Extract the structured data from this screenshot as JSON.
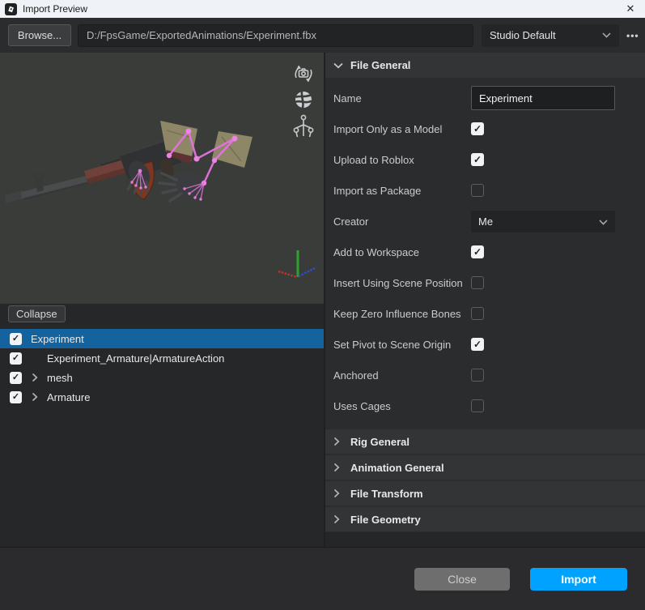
{
  "window": {
    "title": "Import Preview"
  },
  "glyphs": {
    "check": "✓",
    "close": "✕",
    "more": "•••"
  },
  "toolbar": {
    "browse_label": "Browse...",
    "path_value": "D:/FpsGame/ExportedAnimations/Experiment.fbx",
    "preset_value": "Studio Default"
  },
  "viewport": {
    "icons": [
      "orbit-camera-icon",
      "globe-icon",
      "rig-armature-icon"
    ],
    "gizmo_axes": [
      "x-red",
      "y-green",
      "z-blue"
    ]
  },
  "tree": {
    "collapse_label": "Collapse",
    "items": [
      {
        "label": "Experiment",
        "checked": true,
        "selected": true,
        "indent": 0,
        "expandable": false
      },
      {
        "label": "Experiment_Armature|ArmatureAction",
        "checked": true,
        "selected": false,
        "indent": 1,
        "expandable": false
      },
      {
        "label": "mesh",
        "checked": true,
        "selected": false,
        "indent": 0,
        "expandable": true
      },
      {
        "label": "Armature",
        "checked": true,
        "selected": false,
        "indent": 0,
        "expandable": true
      }
    ]
  },
  "inspector": {
    "file_general": {
      "title": "File General",
      "rows": [
        {
          "label": "Name",
          "type": "text",
          "value": "Experiment"
        },
        {
          "label": "Import Only as a Model",
          "type": "checkbox",
          "checked": true
        },
        {
          "label": "Upload to Roblox",
          "type": "checkbox",
          "checked": true
        },
        {
          "label": "Import as Package",
          "type": "checkbox",
          "checked": false
        },
        {
          "label": "Creator",
          "type": "dropdown",
          "value": "Me"
        },
        {
          "label": "Add to Workspace",
          "type": "checkbox",
          "checked": true
        },
        {
          "label": "Insert Using Scene Position",
          "type": "checkbox",
          "checked": false
        },
        {
          "label": "Keep Zero Influence Bones",
          "type": "checkbox",
          "checked": false
        },
        {
          "label": "Set Pivot to Scene Origin",
          "type": "checkbox",
          "checked": true
        },
        {
          "label": "Anchored",
          "type": "checkbox",
          "checked": false
        },
        {
          "label": "Uses Cages",
          "type": "checkbox",
          "checked": false
        }
      ]
    },
    "collapsed_sections": [
      "Rig General",
      "Animation General",
      "File Transform",
      "File Geometry"
    ]
  },
  "footer": {
    "close_label": "Close",
    "import_label": "Import"
  },
  "colors": {
    "accent": "#00A2FF",
    "selection": "#15639E",
    "titlebar": "#EFF2F7",
    "viewport_bg": "#3A3C3A"
  }
}
